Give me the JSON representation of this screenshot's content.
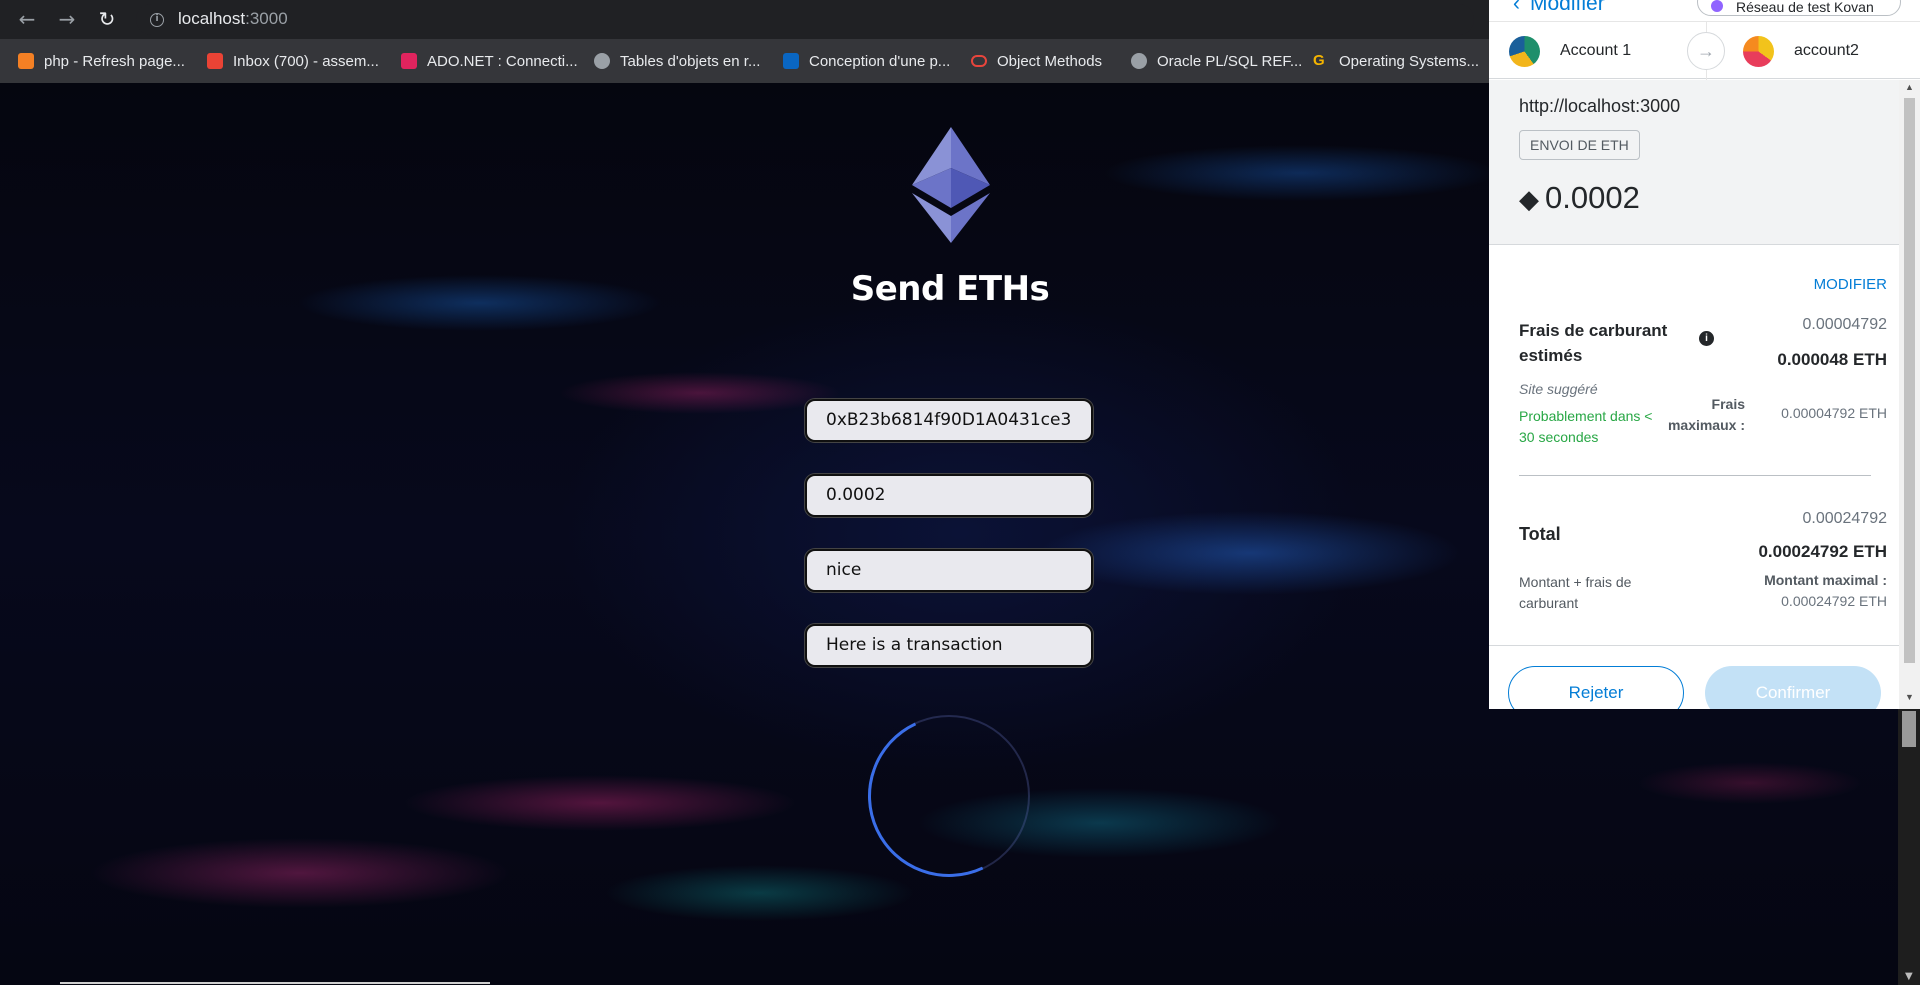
{
  "browser": {
    "url_host": "localhost",
    "url_port": ":3000",
    "bookmarks": [
      {
        "label": "php - Refresh page...",
        "color": "#f48024"
      },
      {
        "label": "Inbox (700) - assem...",
        "color": "#ea4335"
      },
      {
        "label": "ADO.NET : Connecti...",
        "color": "#e0245e"
      },
      {
        "label": "Tables d'objets en r...",
        "color": "#9aa0a6"
      },
      {
        "label": "Conception d'une p...",
        "color": "#0a66c2"
      },
      {
        "label": "Object Methods",
        "color": "#e8453c"
      },
      {
        "label": "Oracle PL/SQL REF...",
        "color": "#9aa0a6"
      },
      {
        "label": "Operating Systems...",
        "color": "#f4b400"
      }
    ]
  },
  "app": {
    "title": "Send ETHs",
    "inputs": {
      "address": "0xB23b6814f90D1A0431ce3",
      "amount": "0.0002",
      "keyword": "nice",
      "message": "Here is a transaction"
    }
  },
  "metamask": {
    "back_label": "Modifier",
    "network": "Réseau de test Kovan",
    "from_account": "Account 1",
    "to_account": "account2",
    "origin": "http://localhost:3000",
    "badge": "ENVOI DE ETH",
    "amount": "0.0002",
    "edit_link": "MODIFIER",
    "gas": {
      "label": "Frais de carburant estimés",
      "secondary": "0.00004792",
      "primary": "0.000048 ETH",
      "site_suggested": "Site suggéré",
      "likely": "Probablement dans < 30 secondes",
      "max_label": "Frais maximaux :",
      "max_value": "0.00004792 ETH"
    },
    "total": {
      "label": "Total",
      "secondary": "0.00024792",
      "primary": "0.00024792 ETH",
      "note": "Montant + frais de carburant",
      "max_label": "Montant maximal :",
      "max_value": "0.00024792 ETH"
    },
    "reject_label": "Rejeter",
    "confirm_label": "Confirmer"
  },
  "colors": {
    "accent": "#037dd6",
    "success": "#28a745",
    "confirm_disabled": "#c3e1f6"
  }
}
